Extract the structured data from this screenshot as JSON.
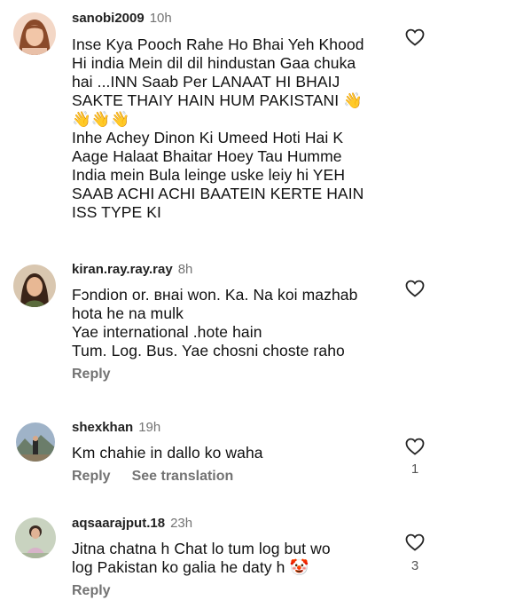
{
  "comments": [
    {
      "username": "sanobi2009",
      "time": "10h",
      "lines": [
        "Inse Kya Pooch Rahe Ho Bhai Yeh Khood",
        "Hi india Mein dil dil hindustan Gaa chuka",
        "hai ...INN Saab Per LANAAT HI BHAIJ",
        "SAKTE THAIY HAIN HUM PAKISTANI 👋",
        "👋👋👋",
        "Inhe Achey Dinon Ki Umeed Hoti Hai K",
        "Aage Halaat Bhaitar Hoey Tau Humme",
        "India mein Bula leinge uske leiy hi YEH",
        "SAAB ACHI ACHI BAATEIN KERTE HAIN",
        "ISS TYPE KI"
      ],
      "like_count": ""
    },
    {
      "username": "kiran.ray.ray.ray",
      "time": "8h",
      "lines": [
        "Fɔndion or. внаi won. Ka. Na koi mazhab",
        "hota he na mulk",
        "Yae international .hote hain",
        "Tum. Log. Bus. Yae chosni choste raho"
      ],
      "reply_label": "Reply",
      "like_count": ""
    },
    {
      "username": "shexkhan",
      "time": "19h",
      "lines": [
        "Km chahie in dallo ko waha"
      ],
      "reply_label": "Reply",
      "translation_label": "See translation",
      "like_count": "1"
    },
    {
      "username": "aqsaarajput.18",
      "time": "23h",
      "lines": [
        "Jitna chatna h Chat lo tum log but wo",
        "log Pakistan ko galia he daty h 🤡"
      ],
      "reply_label": "Reply",
      "like_count": "3"
    }
  ],
  "icons": {
    "like": "heart-outline-icon"
  },
  "colors": {
    "secondary_text": "#737373",
    "heart_stroke": "#262626"
  }
}
